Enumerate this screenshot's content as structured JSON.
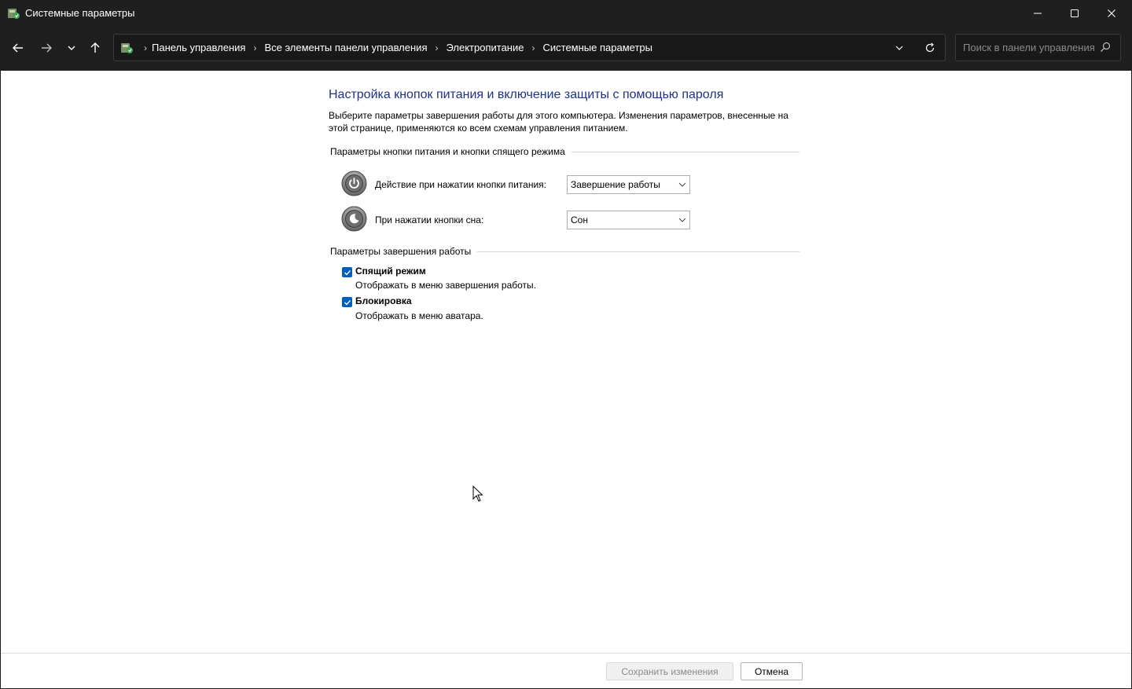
{
  "window": {
    "title": "Системные параметры",
    "app_icon": "power-options-icon",
    "controls": {
      "minimize_icon": "minimize-icon",
      "maximize_icon": "maximize-icon",
      "close_icon": "close-icon"
    }
  },
  "navigation": {
    "back_icon": "arrow-left-icon",
    "forward_icon": "arrow-right-icon",
    "recent_icon": "chevron-down-icon",
    "up_icon": "arrow-up-icon",
    "breadcrumbs": [
      "Панель управления",
      "Все элементы панели управления",
      "Электропитание",
      "Системные параметры"
    ],
    "refresh_icon": "refresh-icon",
    "search": {
      "placeholder": "Поиск в панели управления",
      "value": ""
    }
  },
  "main": {
    "title": "Настройка кнопок питания и включение защиты с помощью пароля",
    "description": "Выберите параметры завершения работы для этого компьютера. Изменения параметров, внесенные на этой странице, применяются ко всем схемам управления питанием.",
    "buttons_group": {
      "header": "Параметры кнопки питания и кнопки спящего режима",
      "power_button": {
        "label": "Действие при нажатии кнопки питания:",
        "value": "Завершение работы"
      },
      "sleep_button": {
        "label": "При нажатии кнопки сна:",
        "value": "Сон"
      }
    },
    "shutdown_group": {
      "header": "Параметры завершения работы",
      "items": [
        {
          "label": "Спящий режим",
          "description": "Отображать в меню завершения работы.",
          "checked": true
        },
        {
          "label": "Блокировка",
          "description": "Отображать в меню аватара.",
          "checked": true
        }
      ]
    }
  },
  "footer": {
    "save_label": "Сохранить изменения",
    "cancel_label": "Отмена"
  },
  "colors": {
    "title_blue": "#1e3287",
    "checkbox_blue": "#005fb8",
    "chrome_dark": "#1f1f1f"
  }
}
